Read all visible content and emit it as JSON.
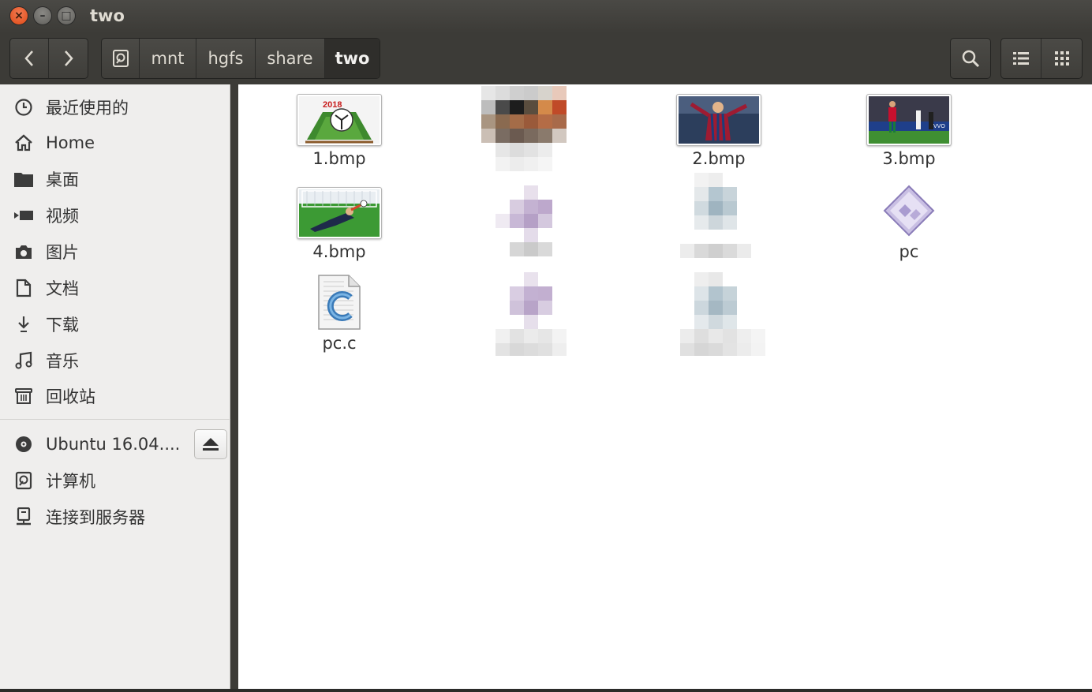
{
  "window": {
    "title": "two"
  },
  "titlebar_buttons": {
    "close": "×",
    "minimize": "–",
    "maximize": "□"
  },
  "toolbar": {
    "back_label": "‹",
    "forward_label": "›",
    "path": [
      "mnt",
      "hgfs",
      "share",
      "two"
    ],
    "search_icon": "search-icon",
    "view_list_icon": "list-view-icon",
    "view_grid_icon": "grid-view-icon"
  },
  "sidebar": {
    "places": [
      {
        "label": "最近使用的",
        "icon": "clock-icon"
      },
      {
        "label": "Home",
        "icon": "home-icon"
      },
      {
        "label": "桌面",
        "icon": "folder-icon"
      },
      {
        "label": "视频",
        "icon": "video-icon"
      },
      {
        "label": "图片",
        "icon": "camera-icon"
      },
      {
        "label": "文档",
        "icon": "document-icon"
      },
      {
        "label": "下载",
        "icon": "download-icon"
      },
      {
        "label": "音乐",
        "icon": "music-icon"
      },
      {
        "label": "回收站",
        "icon": "trash-icon"
      }
    ],
    "devices": [
      {
        "label": "Ubuntu 16.04....",
        "icon": "disc-icon"
      },
      {
        "label": "计算机",
        "icon": "computer-icon"
      },
      {
        "label": "连接到服务器",
        "icon": "server-icon"
      }
    ]
  },
  "files": [
    {
      "name": "1.bmp",
      "type": "image"
    },
    {
      "name": "2.bmp",
      "type": "image"
    },
    {
      "name": "3.bmp",
      "type": "image"
    },
    {
      "name": "4.bmp",
      "type": "image"
    },
    {
      "name": "pc",
      "type": "executable"
    },
    {
      "name": "pc.c",
      "type": "c-source"
    }
  ],
  "colors": {
    "titlebar": "#3c3b37",
    "close_button": "#df4a16",
    "sidebar_bg": "#efeeed",
    "main_bg": "#ffffff"
  }
}
